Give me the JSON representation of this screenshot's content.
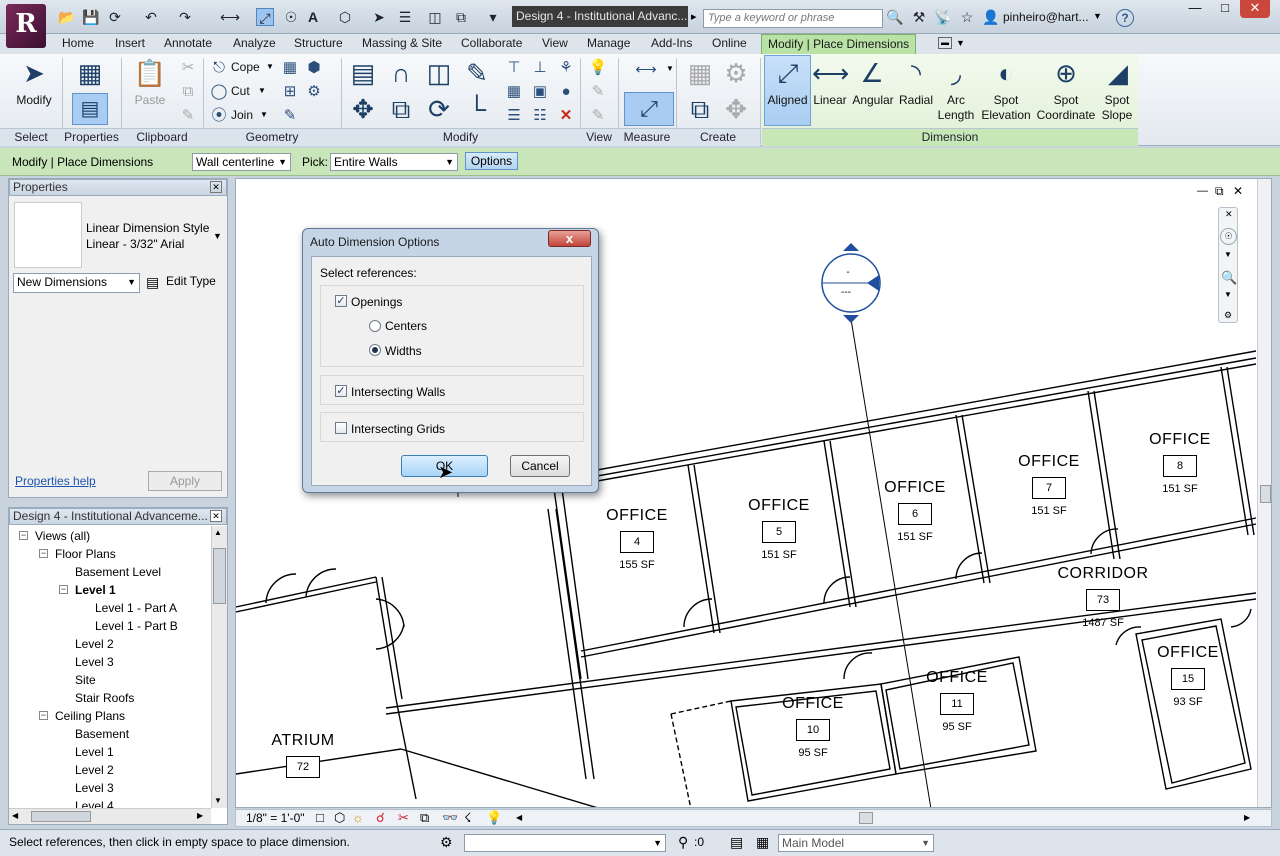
{
  "title_bar": {
    "app_logo": "R",
    "document_title": "Design 4 - Institutional Advanc...",
    "search_placeholder": "Type a keyword or phrase",
    "user": "pinheiro@hart...",
    "help": "?"
  },
  "menu_tabs": [
    "Home",
    "Insert",
    "Annotate",
    "Analyze",
    "Structure",
    "Massing & Site",
    "Collaborate",
    "View",
    "Manage",
    "Add-Ins",
    "Online",
    "Modify | Place Dimensions"
  ],
  "ribbon": {
    "select": {
      "button": "Modify",
      "panel": "Select"
    },
    "properties": {
      "panel": "Properties"
    },
    "clipboard": {
      "button": "Paste",
      "panel": "Clipboard"
    },
    "geometry": {
      "cope": "Cope",
      "cut": "Cut",
      "join": "Join",
      "panel": "Geometry"
    },
    "modify": {
      "panel": "Modify"
    },
    "view": {
      "panel": "View"
    },
    "measure": {
      "panel": "Measure"
    },
    "create": {
      "panel": "Create"
    },
    "dimension": {
      "panel": "Dimension",
      "tools": [
        {
          "l1": "Aligned",
          "l2": ""
        },
        {
          "l1": "Linear",
          "l2": ""
        },
        {
          "l1": "Angular",
          "l2": ""
        },
        {
          "l1": "Radial",
          "l2": ""
        },
        {
          "l1": "Arc",
          "l2": "Length"
        },
        {
          "l1": "Spot",
          "l2": "Elevation"
        },
        {
          "l1": "Spot",
          "l2": "Coordinate"
        },
        {
          "l1": "Spot",
          "l2": "Slope"
        }
      ]
    }
  },
  "options_bar": {
    "context": "Modify | Place Dimensions",
    "placement": "Wall centerline",
    "pick_label": "Pick:",
    "pick_value": "Entire Walls",
    "options_button": "Options"
  },
  "properties_panel": {
    "title": "Properties",
    "type_family": "Linear Dimension Style",
    "type_name": "Linear - 3/32\" Arial",
    "selector": "New Dimensions",
    "edit_type": "Edit Type",
    "help_link": "Properties help",
    "apply": "Apply"
  },
  "project_browser": {
    "title": "Design 4 - Institutional Advanceme...",
    "items": [
      {
        "label": "Views (all)",
        "indent": 0,
        "toggle": "-",
        "bold": false
      },
      {
        "label": "Floor Plans",
        "indent": 1,
        "toggle": "-",
        "bold": false
      },
      {
        "label": "Basement Level",
        "indent": 2,
        "toggle": "",
        "bold": false
      },
      {
        "label": "Level 1",
        "indent": 2,
        "toggle": "-",
        "bold": true
      },
      {
        "label": "Level 1 - Part A",
        "indent": 3,
        "toggle": "",
        "bold": false
      },
      {
        "label": "Level 1 - Part B",
        "indent": 3,
        "toggle": "",
        "bold": false
      },
      {
        "label": "Level 2",
        "indent": 2,
        "toggle": "",
        "bold": false
      },
      {
        "label": "Level 3",
        "indent": 2,
        "toggle": "",
        "bold": false
      },
      {
        "label": "Site",
        "indent": 2,
        "toggle": "",
        "bold": false
      },
      {
        "label": "Stair Roofs",
        "indent": 2,
        "toggle": "",
        "bold": false
      },
      {
        "label": "Ceiling Plans",
        "indent": 1,
        "toggle": "-",
        "bold": false
      },
      {
        "label": "Basement",
        "indent": 2,
        "toggle": "",
        "bold": false
      },
      {
        "label": "Level 1",
        "indent": 2,
        "toggle": "",
        "bold": false
      },
      {
        "label": "Level 2",
        "indent": 2,
        "toggle": "",
        "bold": false
      },
      {
        "label": "Level 3",
        "indent": 2,
        "toggle": "",
        "bold": false
      },
      {
        "label": "Level 4",
        "indent": 2,
        "toggle": "",
        "bold": false
      }
    ]
  },
  "rooms": [
    {
      "name": "OFFICE",
      "number": "4",
      "area": "155 SF"
    },
    {
      "name": "OFFICE",
      "number": "5",
      "area": "151 SF"
    },
    {
      "name": "OFFICE",
      "number": "6",
      "area": "151 SF"
    },
    {
      "name": "OFFICE",
      "number": "7",
      "area": "151 SF"
    },
    {
      "name": "OFFICE",
      "number": "8",
      "area": "151 SF"
    },
    {
      "name": "CORRIDOR",
      "number": "73",
      "area": "1487 SF"
    },
    {
      "name": "OFFICE",
      "number": "15",
      "area": "93 SF"
    },
    {
      "name": "OFFICE",
      "number": "11",
      "area": "95 SF"
    },
    {
      "name": "OFFICE",
      "number": "10",
      "area": "95 SF"
    },
    {
      "name": "ATRIUM",
      "number": "72",
      "area": ""
    }
  ],
  "level_marker": {
    "top": "-",
    "bottom": "---"
  },
  "dialog": {
    "title": "Auto Dimension Options",
    "close": "x",
    "section_label": "Select references:",
    "openings": {
      "label": "Openings",
      "checked": true
    },
    "centers": {
      "label": "Centers",
      "selected": false
    },
    "widths": {
      "label": "Widths",
      "selected": true
    },
    "intersecting_walls": {
      "label": "Intersecting Walls",
      "checked": true
    },
    "intersecting_grids": {
      "label": "Intersecting Grids",
      "checked": false
    },
    "ok": "OK",
    "cancel": "Cancel"
  },
  "view_control_bar": {
    "scale": "1/8\" = 1'-0\""
  },
  "status_bar": {
    "message": "Select references, then click in empty space to place dimension.",
    "selection_count": ":0",
    "model": "Main Model"
  },
  "colors": {
    "contextual_tab": "#b9e3a6",
    "options_bar": "#c9e6bb",
    "dialog_frame": "#c5d5e6",
    "active_tool": "#a9cdf2"
  }
}
